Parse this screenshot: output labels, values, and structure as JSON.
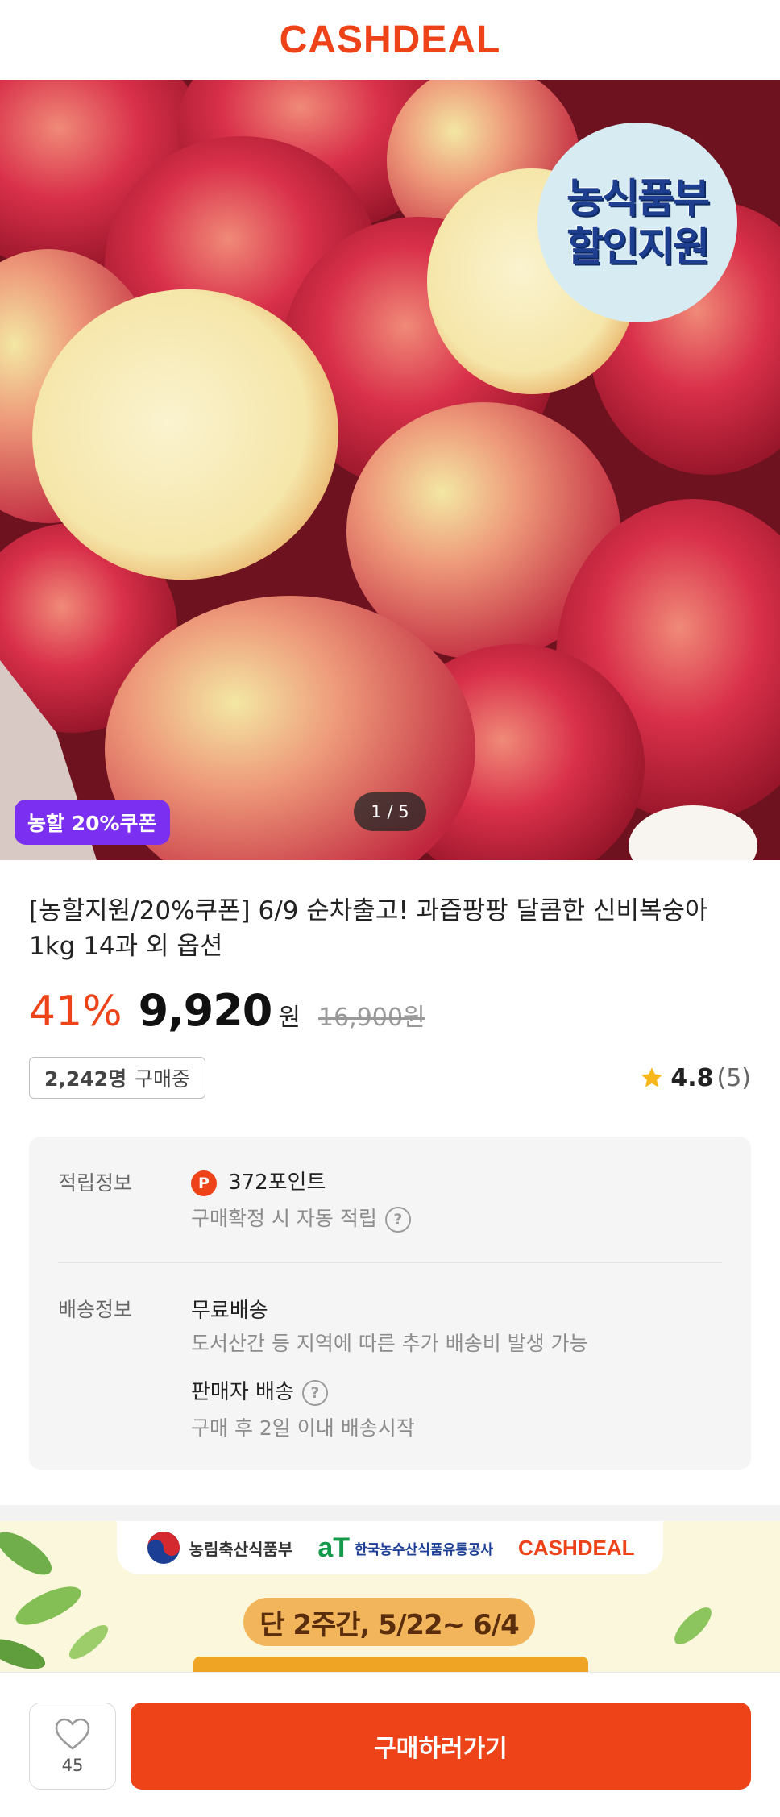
{
  "header": {
    "logo": "CASHDEAL"
  },
  "hero": {
    "badge_lines": [
      "농식품부",
      "할인지원"
    ],
    "coupon_tag": "농할 20%쿠폰",
    "counter": "1 / 5"
  },
  "product": {
    "title": "[농할지원/20%쿠폰] 6/9 순차출고! 과즙팡팡 달콤한 신비복숭아 1kg 14과 외 옵션",
    "discount": "41%",
    "price": "9,920",
    "currency": "원",
    "original_price": "16,900원",
    "buyers_count": "2,242명",
    "buyers_suffix": "구매중",
    "rating_score": "4.8",
    "rating_count": "(5)"
  },
  "info": {
    "points_label": "적립정보",
    "points_icon": "P",
    "points_value": "372포인트",
    "points_note": "구매확정 시 자동 적립",
    "shipping_label": "배송정보",
    "shipping_free": "무료배송",
    "shipping_note": "도서산간 등 지역에 따른 추가 배송비 발생 가능",
    "seller_shipping": "판매자 배송",
    "seller_note": "구매 후 2일 이내 배송시작",
    "help_icon": "?"
  },
  "banner": {
    "org1": "농림축산식품부",
    "org2_mark": "aT",
    "org2": "한국농수산식품유통공사",
    "brand": "CASHDEAL",
    "period": "단 2주간, 5/22~ 6/4"
  },
  "bottom": {
    "like_count": "45",
    "buy_label": "구매하러가기"
  },
  "colors": {
    "brand": "#ee4218",
    "coupon_purple": "#7b2ff0",
    "star": "#f6b71b"
  }
}
